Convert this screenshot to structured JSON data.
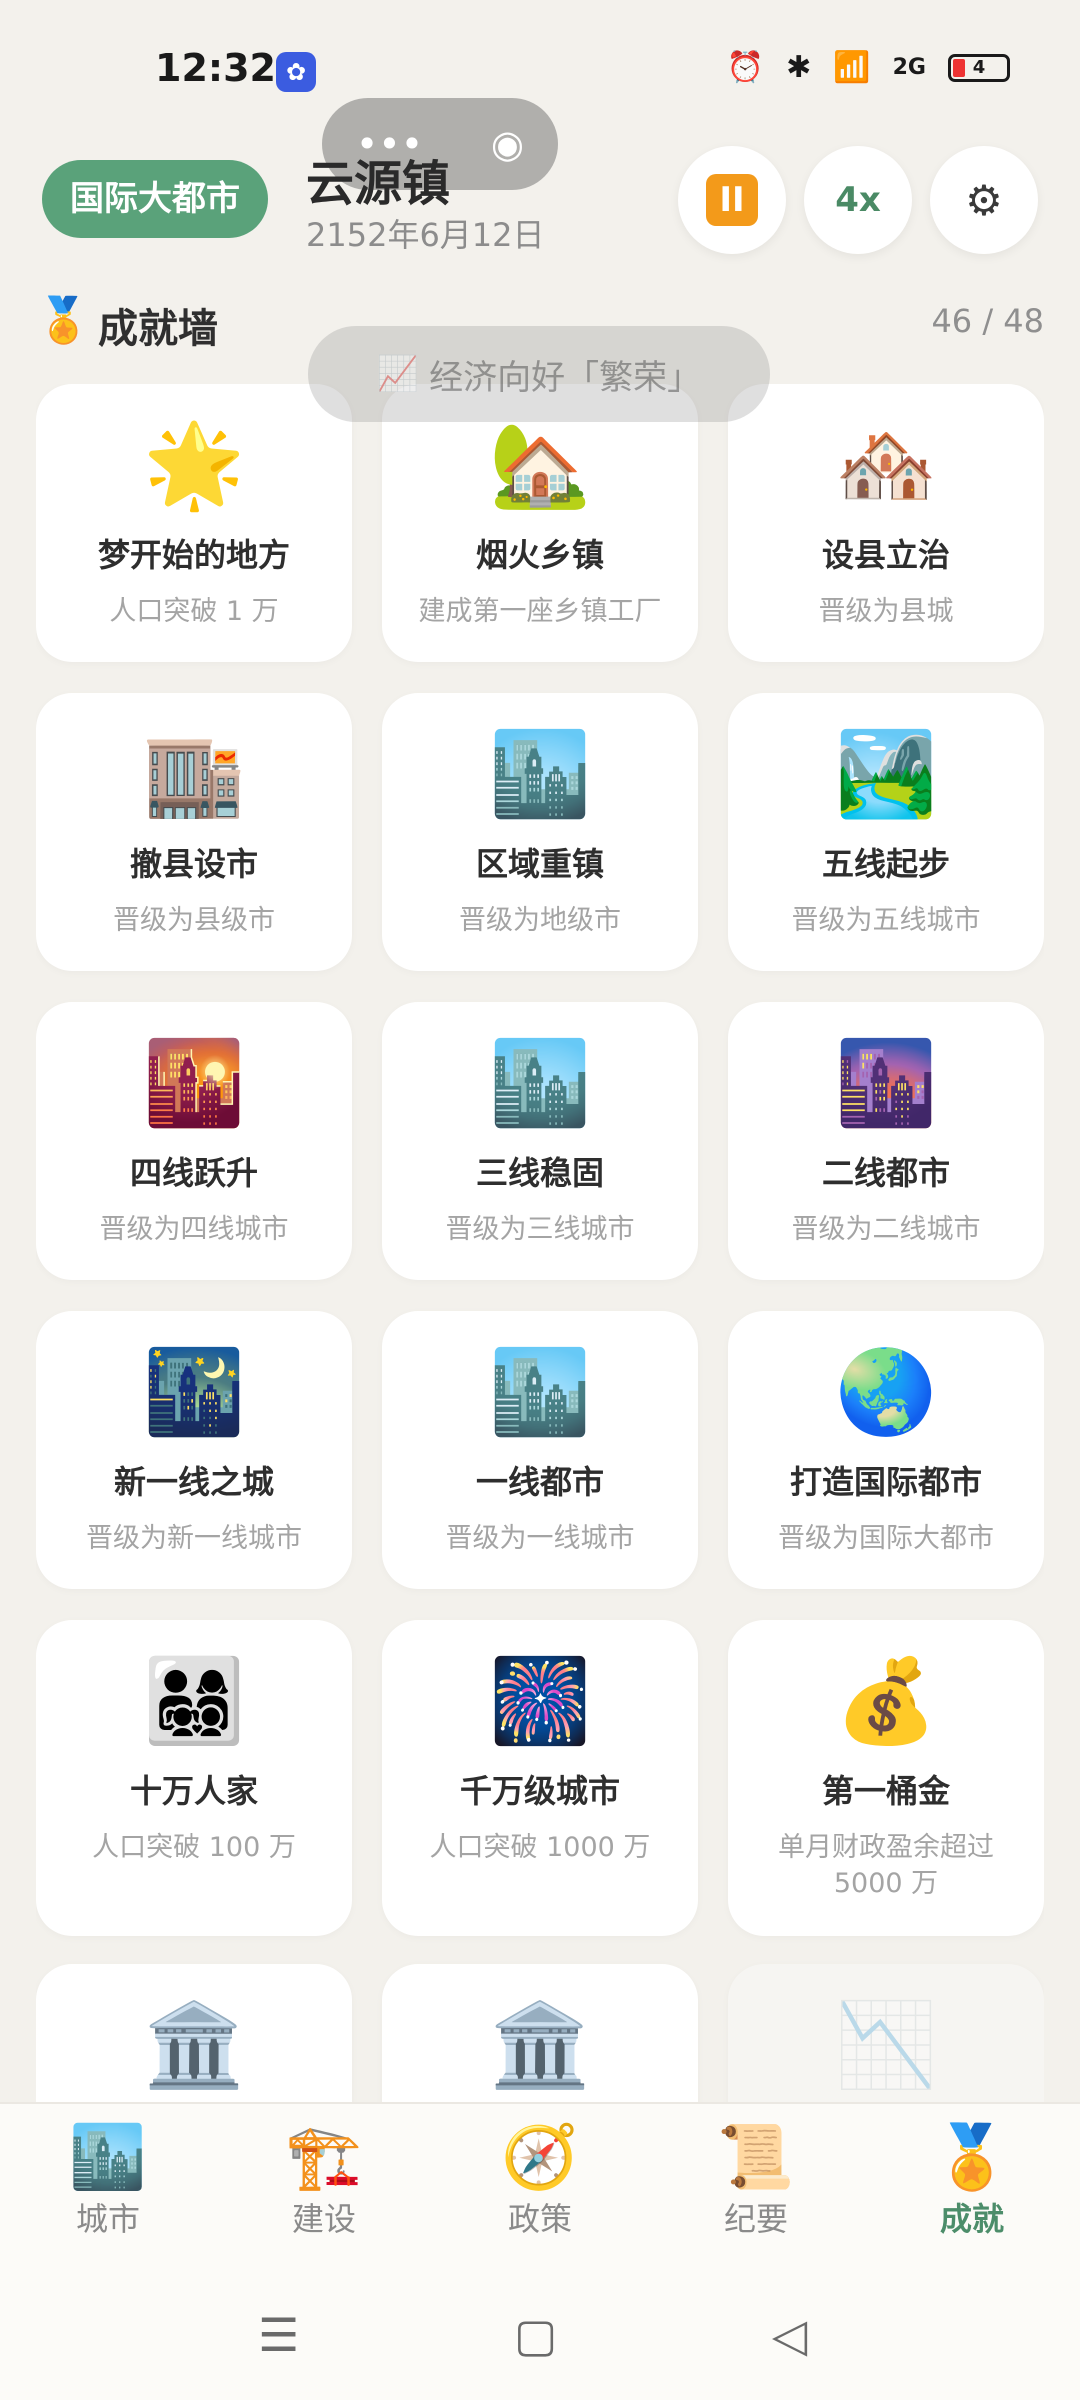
{
  "status": {
    "time": "12:32",
    "app_badge": "✿",
    "alarm": "⏰",
    "bluetooth": "✱",
    "wifi": "📶",
    "signal": "2G",
    "battery": "4"
  },
  "capsule": {
    "more": "•••",
    "close": "◉"
  },
  "header": {
    "city_level": "国际大都市",
    "town": "云源镇",
    "date": "2152年6月12日",
    "pause": "II",
    "speed": "4x",
    "settings": "⚙"
  },
  "section": {
    "medal": "🏅",
    "title": "成就墙",
    "progress": "46 / 48"
  },
  "toast": {
    "icon": "📈",
    "text": "经济向好「繁荣」"
  },
  "achievements": [
    {
      "icon": "🌟",
      "title": "梦开始的地方",
      "desc": "人口突破 1 万"
    },
    {
      "icon": "🏡",
      "title": "烟火乡镇",
      "desc": "建成第一座乡镇工厂"
    },
    {
      "icon": "🏘️",
      "title": "设县立治",
      "desc": "晋级为县城"
    },
    {
      "icon": "🏬",
      "title": "撤县设市",
      "desc": "晋级为县级市"
    },
    {
      "icon": "🏙️",
      "title": "区域重镇",
      "desc": "晋级为地级市"
    },
    {
      "icon": "🏞️",
      "title": "五线起步",
      "desc": "晋级为五线城市"
    },
    {
      "icon": "🌇",
      "title": "四线跃升",
      "desc": "晋级为四线城市"
    },
    {
      "icon": "🏙️",
      "title": "三线稳固",
      "desc": "晋级为三线城市"
    },
    {
      "icon": "🌆",
      "title": "二线都市",
      "desc": "晋级为二线城市"
    },
    {
      "icon": "🌃",
      "title": "新一线之城",
      "desc": "晋级为新一线城市"
    },
    {
      "icon": "🏙️",
      "title": "一线都市",
      "desc": "晋级为一线城市"
    },
    {
      "icon": "🌏",
      "title": "打造国际都市",
      "desc": "晋级为国际大都市"
    },
    {
      "icon": "👨‍👩‍👧‍👦",
      "title": "十万人家",
      "desc": "人口突破 100 万"
    },
    {
      "icon": "🎆",
      "title": "千万级城市",
      "desc": "人口突破 1000 万"
    },
    {
      "icon": "💰",
      "title": "第一桶金",
      "desc": "单月财政盈余超过 5000 万"
    },
    {
      "icon": "🏛️",
      "title": "",
      "desc": ""
    },
    {
      "icon": "🏛️",
      "title": "",
      "desc": ""
    },
    {
      "icon": "📉",
      "title": "",
      "desc": ""
    }
  ],
  "tabs": [
    {
      "icon": "🏙️",
      "label": "城市"
    },
    {
      "icon": "🏗️",
      "label": "建设"
    },
    {
      "icon": "🧭",
      "label": "政策"
    },
    {
      "icon": "📜",
      "label": "纪要"
    },
    {
      "icon": "🏅",
      "label": "成就"
    }
  ],
  "nav": {
    "menu": "☰",
    "home": "▢",
    "back": "◁"
  }
}
